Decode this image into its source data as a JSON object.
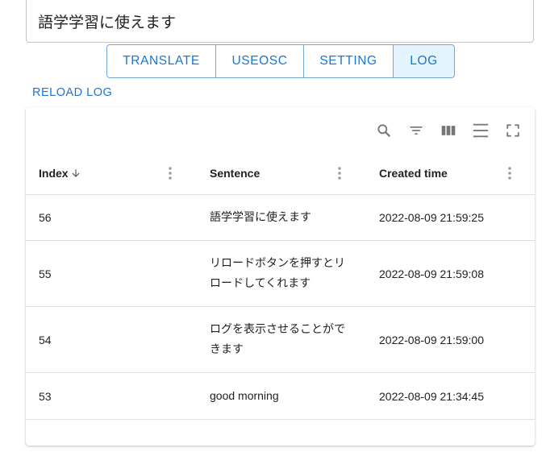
{
  "input": {
    "value": "語学学習に使えます"
  },
  "tabs": [
    {
      "label": "TRANSLATE",
      "selected": false
    },
    {
      "label": "USEOSC",
      "selected": false
    },
    {
      "label": "SETTING",
      "selected": false
    },
    {
      "label": "LOG",
      "selected": true
    }
  ],
  "reload_label": "RELOAD LOG",
  "toolbar": {
    "icons": [
      "search-icon",
      "filter-icon",
      "columns-icon",
      "density-icon",
      "fullscreen-icon"
    ]
  },
  "table": {
    "columns": [
      {
        "label": "Index",
        "sort": "descending"
      },
      {
        "label": "Sentence"
      },
      {
        "label": "Created time"
      }
    ],
    "rows": [
      {
        "index": "56",
        "sentence_lines": [
          "語学学習に使えます"
        ],
        "created": "2022-08-09 21:59:25"
      },
      {
        "index": "55",
        "sentence_lines": [
          "リロードボタンを押すとリ",
          "ロードしてくれます"
        ],
        "created": "2022-08-09 21:59:08"
      },
      {
        "index": "54",
        "sentence_lines": [
          "ログを表示させることがで",
          "きます"
        ],
        "created": "2022-08-09 21:59:00"
      },
      {
        "index": "53",
        "sentence_lines": [
          "good morning"
        ],
        "created": "2022-08-09 21:34:45"
      }
    ]
  },
  "colors": {
    "accent": "#1976d2",
    "selected_tab_bg": "#e3f4fc",
    "border": "#6fa8dc",
    "divider": "#e0e0e0",
    "icon": "#757575"
  }
}
